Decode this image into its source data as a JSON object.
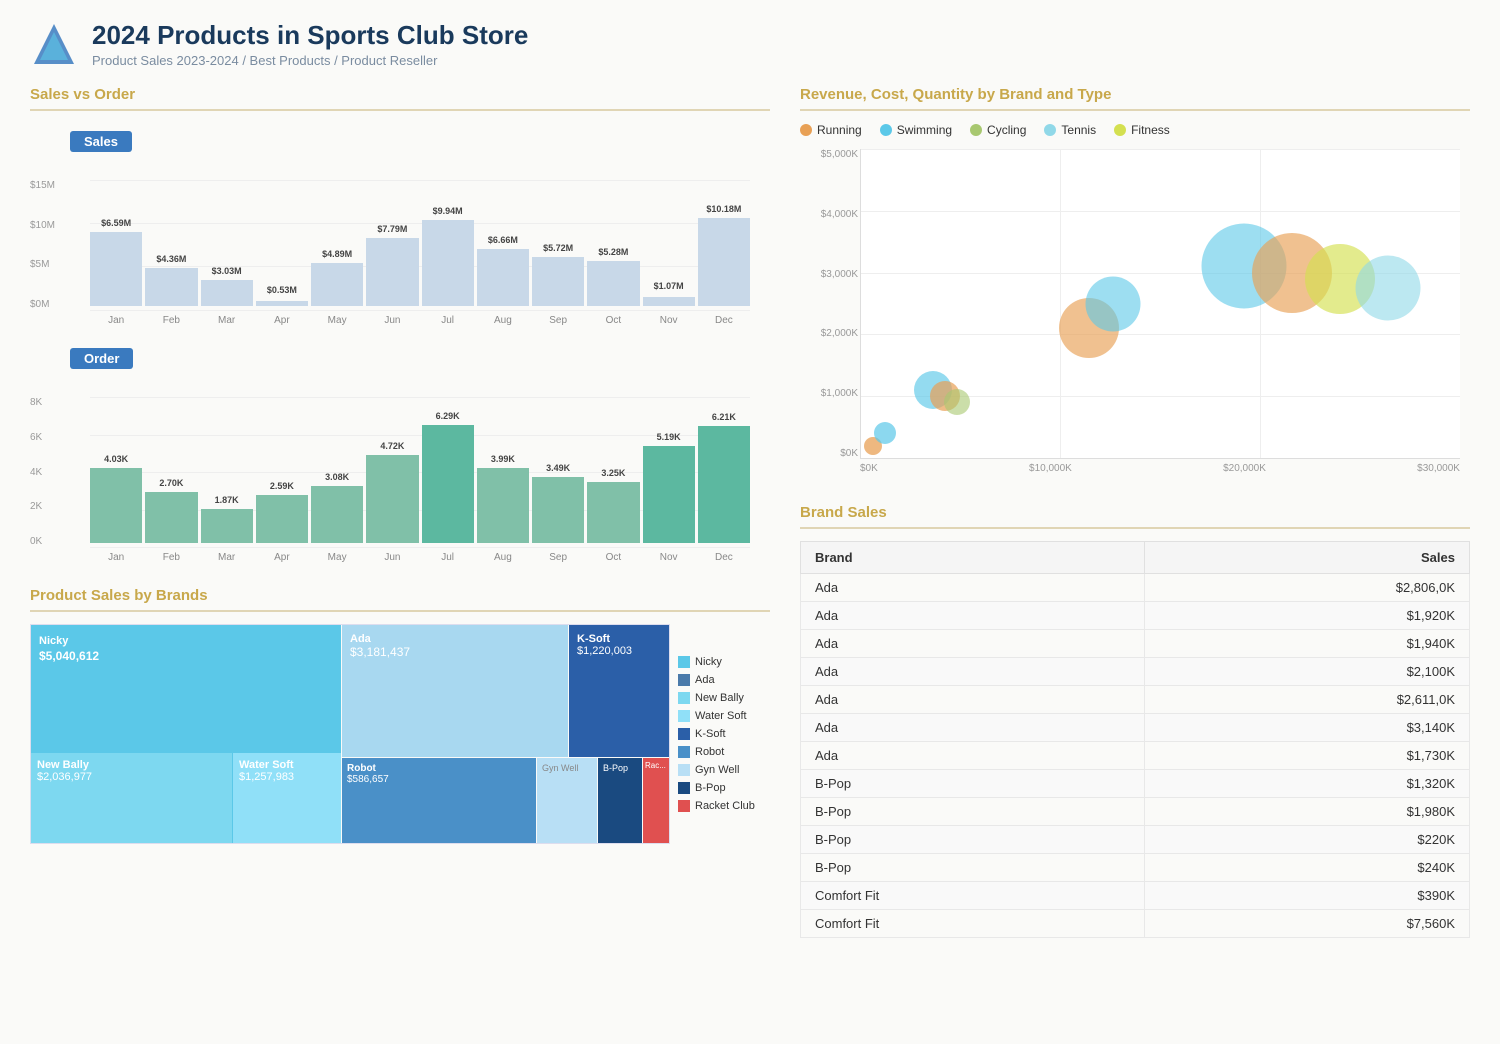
{
  "header": {
    "title": "2024 Products in Sports Club Store",
    "subtitle": "Product Sales 2023-2024 / Best Products / Product Reseller"
  },
  "sales_order_section": {
    "title": "Sales vs Order",
    "sales_label": "Sales",
    "order_label": "Order",
    "sales_y_ticks": [
      "$15M",
      "$10M",
      "$5M",
      "$0M"
    ],
    "order_y_ticks": [
      "8K",
      "6K",
      "4K",
      "2K",
      "0K"
    ],
    "months": [
      "Jan",
      "Feb",
      "Mar",
      "Apr",
      "May",
      "Jun",
      "Jul",
      "Aug",
      "Sep",
      "Oct",
      "Nov",
      "Dec"
    ],
    "sales_values": [
      6.59,
      4.36,
      3.03,
      0.53,
      4.89,
      7.79,
      9.94,
      6.66,
      5.72,
      5.28,
      1.07,
      10.18
    ],
    "sales_labels": [
      "$6.59M",
      "$4.36M",
      "$3.03M",
      "$0.53M",
      "$4.89M",
      "$7.79M",
      "$9.94M",
      "$6.66M",
      "$5.72M",
      "$5.28M",
      "$1.07M",
      "$10.18M"
    ],
    "order_values": [
      4.03,
      2.7,
      1.87,
      2.59,
      3.08,
      4.72,
      6.29,
      3.99,
      3.49,
      3.25,
      5.19,
      6.21
    ],
    "order_labels": [
      "4.03K",
      "2.70K",
      "1.87K",
      "2.59K",
      "3.08K",
      "4.72K",
      "6.29K",
      "3.99K",
      "3.49K",
      "3.25K",
      "5.19K",
      "6.21K"
    ]
  },
  "bubble_section": {
    "title": "Revenue, Cost, Quantity by Brand and Type",
    "legend": [
      {
        "label": "Running",
        "color": "#e8a055"
      },
      {
        "label": "Swimming",
        "color": "#5bc8e8"
      },
      {
        "label": "Cycling",
        "color": "#a8c870"
      },
      {
        "label": "Tennis",
        "color": "#90d8e8"
      },
      {
        "label": "Fitness",
        "color": "#d4e050"
      }
    ],
    "y_ticks": [
      "$5,000K",
      "$4,000K",
      "$3,000K",
      "$2,000K",
      "$1,000K",
      "$0K"
    ],
    "x_ticks": [
      "$0K",
      "$10,000K",
      "$20,000K",
      "$30,000K"
    ],
    "bubbles": [
      {
        "x": 5,
        "y": 88,
        "size": 28,
        "color": "#5bc8e8",
        "opacity": 0.7
      },
      {
        "x": 7,
        "y": 82,
        "size": 22,
        "color": "#e8a055",
        "opacity": 0.7
      },
      {
        "x": 9,
        "y": 78,
        "size": 20,
        "color": "#a8c870",
        "opacity": 0.6
      },
      {
        "x": 12,
        "y": 68,
        "size": 32,
        "color": "#5bc8e8",
        "opacity": 0.65
      },
      {
        "x": 15,
        "y": 58,
        "size": 28,
        "color": "#e8a055",
        "opacity": 0.7
      },
      {
        "x": 22,
        "y": 35,
        "size": 55,
        "color": "#5bc8e8",
        "opacity": 0.6
      },
      {
        "x": 25,
        "y": 25,
        "size": 60,
        "color": "#e8a055",
        "opacity": 0.65
      },
      {
        "x": 28,
        "y": 22,
        "size": 50,
        "color": "#d4e050",
        "opacity": 0.65
      },
      {
        "x": 30,
        "y": 20,
        "size": 45,
        "color": "#90d8e8",
        "opacity": 0.6
      }
    ]
  },
  "brand_sales_section": {
    "title": "Brand Sales",
    "columns": [
      "Brand",
      "Sales"
    ],
    "rows": [
      {
        "brand": "Ada",
        "sales": "$2,806,0K"
      },
      {
        "brand": "Ada",
        "sales": "$1,920K"
      },
      {
        "brand": "Ada",
        "sales": "$1,940K"
      },
      {
        "brand": "Ada",
        "sales": "$2,100K"
      },
      {
        "brand": "Ada",
        "sales": "$2,611,0K"
      },
      {
        "brand": "Ada",
        "sales": "$3,140K"
      },
      {
        "brand": "Ada",
        "sales": "$1,730K"
      },
      {
        "brand": "B-Pop",
        "sales": "$1,320K"
      },
      {
        "brand": "B-Pop",
        "sales": "$1,980K"
      },
      {
        "brand": "B-Pop",
        "sales": "$220K"
      },
      {
        "brand": "B-Pop",
        "sales": "$240K"
      },
      {
        "brand": "Comfort Fit",
        "sales": "$390K"
      },
      {
        "brand": "Comfort Fit",
        "sales": "$7,560K"
      }
    ]
  },
  "product_brands_section": {
    "title": "Product Sales by Brands",
    "segments": [
      {
        "name": "Nicky",
        "value": "$5,040,612",
        "color": "#5bc8e8"
      },
      {
        "name": "Ada",
        "value": "$3,181,437",
        "color": "#a8d8f0"
      },
      {
        "name": "New Bally",
        "value": "$2,036,977",
        "color": "#7dd8f0"
      },
      {
        "name": "Water Soft",
        "value": "$1,257,983",
        "color": "#90e0f8"
      },
      {
        "name": "K-Soft",
        "value": "$1,220,003",
        "color": "#2b5fa8"
      },
      {
        "name": "Robot",
        "value": "$586,657",
        "color": "#4a90c8"
      },
      {
        "name": "Gyn Well",
        "value": "",
        "color": "#b8dff5"
      },
      {
        "name": "B-Pop",
        "value": "",
        "color": "#1a4a80"
      },
      {
        "name": "Racket Club",
        "value": "",
        "color": "#e05050"
      }
    ],
    "legend": [
      {
        "label": "Nicky",
        "color": "#5bc8e8"
      },
      {
        "label": "Ada",
        "color": "#4a7aaa"
      },
      {
        "label": "New Bally",
        "color": "#7dd8f0"
      },
      {
        "label": "Water Soft",
        "color": "#90e0f8"
      },
      {
        "label": "K-Soft",
        "color": "#2b5fa8"
      },
      {
        "label": "Robot",
        "color": "#4a90c8"
      },
      {
        "label": "Gyn Well",
        "color": "#b8dff5"
      },
      {
        "label": "B-Pop",
        "color": "#1a4a80"
      },
      {
        "label": "Racket Club",
        "color": "#e05050"
      }
    ]
  }
}
